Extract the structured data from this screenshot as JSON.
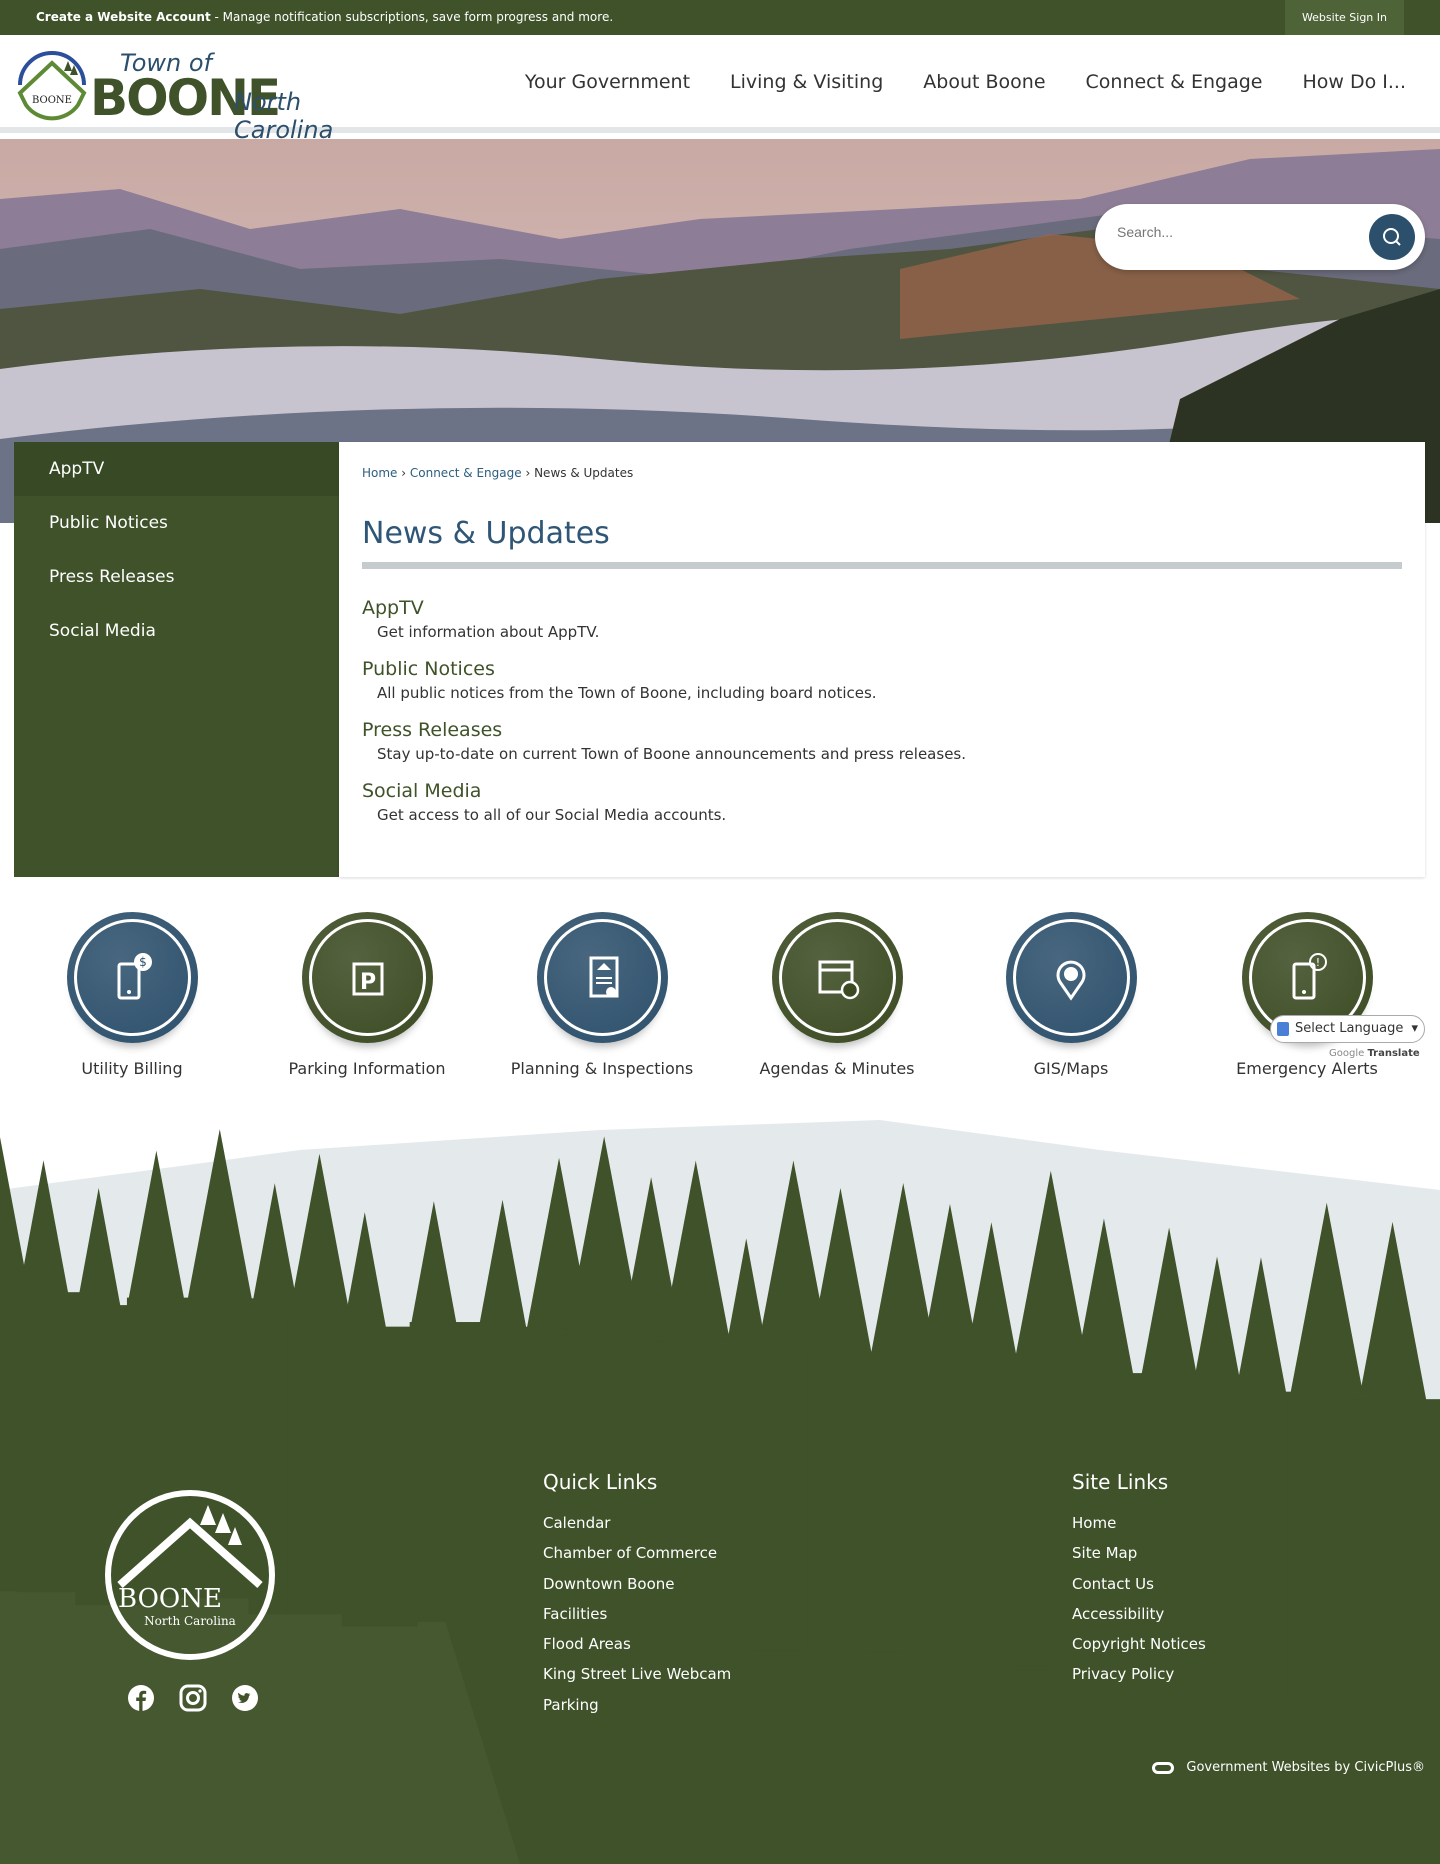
{
  "topbar": {
    "account_link": "Create a Website Account",
    "account_desc": " - Manage notification subscriptions, save form progress and more.",
    "sign_in": "Website Sign In"
  },
  "logo": {
    "town_of": "Town of",
    "name": "BOONE",
    "state": "North Carolina",
    "badge_text": "BOONE North Carolina"
  },
  "nav": [
    "Your Government",
    "Living & Visiting",
    "About Boone",
    "Connect & Engage",
    "How Do I..."
  ],
  "search": {
    "placeholder": "Search..."
  },
  "sidebar": [
    "AppTV",
    "Public Notices",
    "Press Releases",
    "Social Media"
  ],
  "breadcrumb": {
    "home": "Home",
    "parent": "Connect & Engage",
    "current": "News & Updates",
    "sep": " › "
  },
  "page_title": "News & Updates",
  "items": [
    {
      "title": "AppTV",
      "desc": "Get information about AppTV."
    },
    {
      "title": "Public Notices",
      "desc": "All public notices from the Town of Boone, including board notices."
    },
    {
      "title": "Press Releases",
      "desc": "Stay up-to-date on current Town of Boone announcements and press releases."
    },
    {
      "title": "Social Media",
      "desc": "Get access to all of our Social Media accounts."
    }
  ],
  "quick_links": [
    {
      "label": "Utility Billing",
      "color": "#2c4f6b",
      "icon": "phone-dollar-icon"
    },
    {
      "label": "Parking Information",
      "color": "#3b4a22",
      "icon": "parking-icon"
    },
    {
      "label": "Planning & Inspections",
      "color": "#2c4f6b",
      "icon": "certificate-icon"
    },
    {
      "label": "Agendas & Minutes",
      "color": "#3b4a22",
      "icon": "calendar-clock-icon"
    },
    {
      "label": "GIS/Maps",
      "color": "#2c4f6b",
      "icon": "map-pin-icon"
    },
    {
      "label": "Emergency Alerts",
      "color": "#3b4a22",
      "icon": "phone-alert-icon"
    }
  ],
  "translate": {
    "select": "Select Language",
    "powered": "Google",
    "translate": "Translate"
  },
  "footer": {
    "quick_title": "Quick Links",
    "quick": [
      "Calendar",
      "Chamber of Commerce",
      "Downtown Boone",
      "Facilities",
      "Flood Areas",
      "King Street Live Webcam",
      "Parking"
    ],
    "site_title": "Site Links",
    "site": [
      "Home",
      "Site Map",
      "Contact Us",
      "Accessibility",
      "Copyright Notices",
      "Privacy Policy"
    ],
    "civic": "Government Websites by CivicPlus®"
  },
  "colors": {
    "green": "#3f5229",
    "blue": "#2c4f6b"
  }
}
